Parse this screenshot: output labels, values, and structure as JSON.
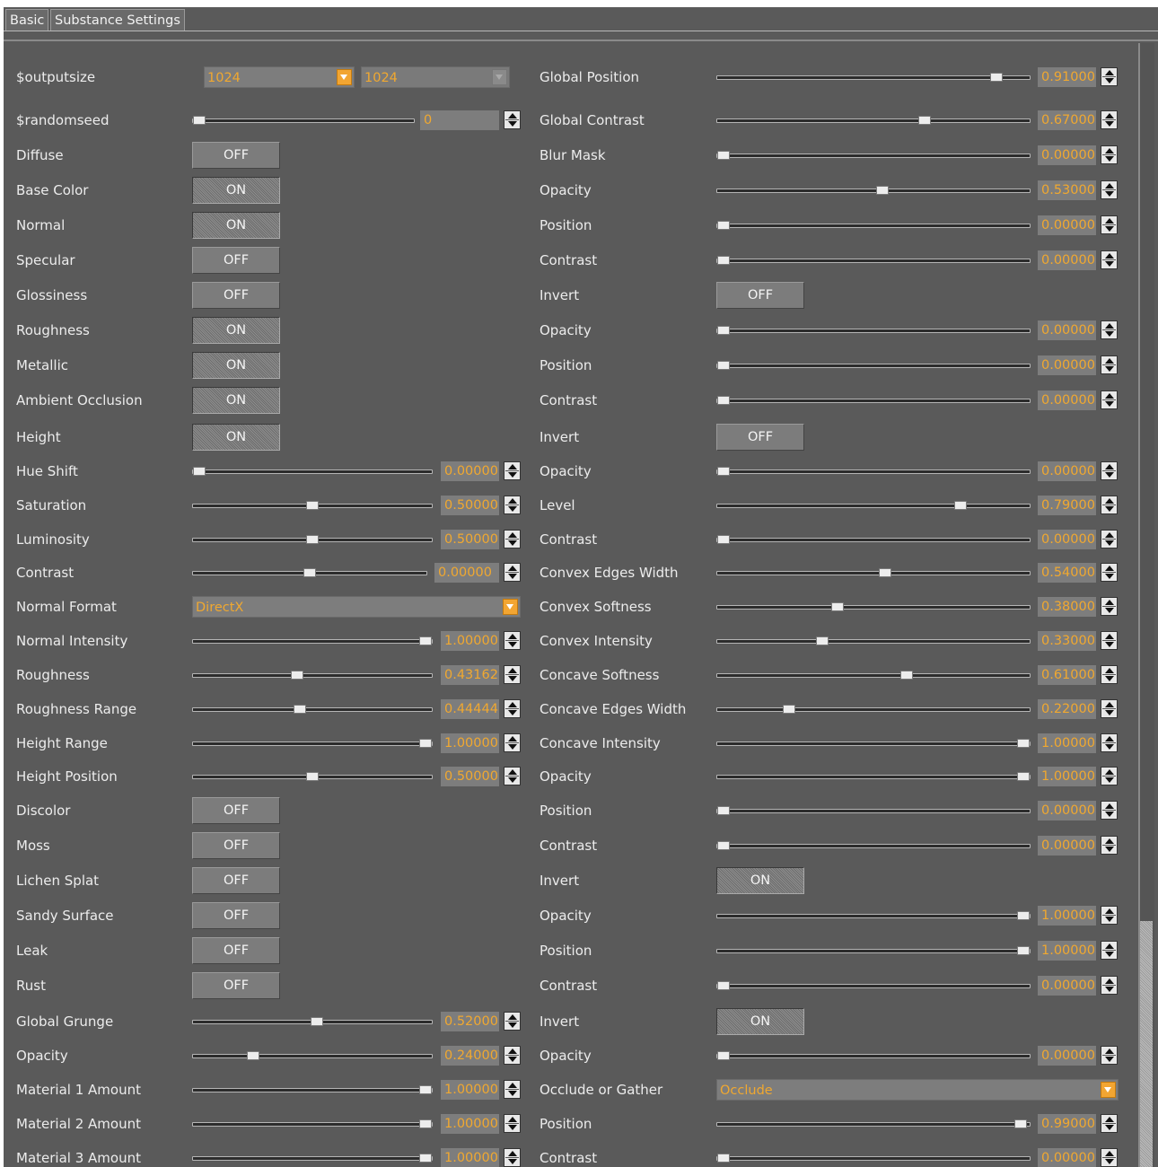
{
  "tabs": [
    "Basic",
    "Substance Settings"
  ],
  "colors": {
    "panel": "#5a5a5a",
    "value_text": "#f0a830",
    "label_text": "#ececec",
    "dropdown_arrow": "#f2a532"
  },
  "left": [
    {
      "label": "$outputsize",
      "type": "dual_dropdown",
      "values": [
        "1024",
        "1024"
      ]
    },
    {
      "label": "$randomseed",
      "type": "slider",
      "value": "0",
      "pos": 0.0
    },
    {
      "label": "Diffuse",
      "type": "toggle",
      "value": "OFF"
    },
    {
      "label": "Base Color",
      "type": "toggle",
      "value": "ON"
    },
    {
      "label": "Normal",
      "type": "toggle",
      "value": "ON"
    },
    {
      "label": "Specular",
      "type": "toggle",
      "value": "OFF"
    },
    {
      "label": "Glossiness",
      "type": "toggle",
      "value": "OFF"
    },
    {
      "label": "Roughness",
      "type": "toggle",
      "value": "ON"
    },
    {
      "label": "Metallic",
      "type": "toggle",
      "value": "ON"
    },
    {
      "label": "Ambient Occlusion",
      "type": "toggle",
      "value": "ON"
    },
    {
      "label": "Height",
      "type": "toggle",
      "value": "ON"
    },
    {
      "label": "Hue Shift",
      "type": "slider",
      "value": "0.00000",
      "pos": 0.0
    },
    {
      "label": "Saturation",
      "type": "slider",
      "value": "0.50000",
      "pos": 0.5
    },
    {
      "label": "Luminosity",
      "type": "slider",
      "value": "0.50000",
      "pos": 0.5
    },
    {
      "label": "Contrast",
      "type": "slider",
      "value": "0.00000",
      "pos": 0.5
    },
    {
      "label": "Normal Format",
      "type": "dropdown",
      "value": "DirectX"
    },
    {
      "label": "Normal Intensity",
      "type": "slider",
      "value": "1.00000",
      "pos": 1.0
    },
    {
      "label": "Roughness",
      "type": "slider",
      "value": "0.43162",
      "pos": 0.43162
    },
    {
      "label": "Roughness Range",
      "type": "slider",
      "value": "0.44444",
      "pos": 0.44444
    },
    {
      "label": "Height Range",
      "type": "slider",
      "value": "1.00000",
      "pos": 1.0
    },
    {
      "label": "Height Position",
      "type": "slider",
      "value": "0.50000",
      "pos": 0.5
    },
    {
      "label": "Discolor",
      "type": "toggle",
      "value": "OFF"
    },
    {
      "label": "Moss",
      "type": "toggle",
      "value": "OFF"
    },
    {
      "label": "Lichen Splat",
      "type": "toggle",
      "value": "OFF"
    },
    {
      "label": "Sandy Surface",
      "type": "toggle",
      "value": "OFF"
    },
    {
      "label": "Leak",
      "type": "toggle",
      "value": "OFF"
    },
    {
      "label": "Rust",
      "type": "toggle",
      "value": "OFF"
    },
    {
      "label": "Global Grunge",
      "type": "slider",
      "value": "0.52000",
      "pos": 0.52
    },
    {
      "label": "Opacity",
      "type": "slider",
      "value": "0.24000",
      "pos": 0.24
    },
    {
      "label": "Material 1 Amount",
      "type": "slider",
      "value": "1.00000",
      "pos": 1.0
    },
    {
      "label": "Material 2 Amount",
      "type": "slider",
      "value": "1.00000",
      "pos": 1.0
    },
    {
      "label": "Material 3 Amount",
      "type": "slider",
      "value": "1.00000",
      "pos": 1.0
    }
  ],
  "right": [
    {
      "label": "Global Position",
      "type": "slider",
      "value": "0.91000",
      "pos": 0.91
    },
    {
      "label": "Global Contrast",
      "type": "slider",
      "value": "0.67000",
      "pos": 0.67
    },
    {
      "label": "Blur Mask",
      "type": "slider",
      "value": "0.00000",
      "pos": 0.0
    },
    {
      "label": "Opacity",
      "type": "slider",
      "value": "0.53000",
      "pos": 0.53
    },
    {
      "label": "Position",
      "type": "slider",
      "value": "0.00000",
      "pos": 0.0
    },
    {
      "label": "Contrast",
      "type": "slider",
      "value": "0.00000",
      "pos": 0.0
    },
    {
      "label": "Invert",
      "type": "toggle",
      "value": "OFF"
    },
    {
      "label": "Opacity",
      "type": "slider",
      "value": "0.00000",
      "pos": 0.0
    },
    {
      "label": "Position",
      "type": "slider",
      "value": "0.00000",
      "pos": 0.0
    },
    {
      "label": "Contrast",
      "type": "slider",
      "value": "0.00000",
      "pos": 0.0
    },
    {
      "label": "Invert",
      "type": "toggle",
      "value": "OFF"
    },
    {
      "label": "Opacity",
      "type": "slider",
      "value": "0.00000",
      "pos": 0.0
    },
    {
      "label": "Level",
      "type": "slider",
      "value": "0.79000",
      "pos": 0.79
    },
    {
      "label": "Contrast",
      "type": "slider",
      "value": "0.00000",
      "pos": 0.0
    },
    {
      "label": "Convex Edges Width",
      "type": "slider",
      "value": "0.54000",
      "pos": 0.54
    },
    {
      "label": "Convex Softness",
      "type": "slider",
      "value": "0.38000",
      "pos": 0.38
    },
    {
      "label": "Convex Intensity",
      "type": "slider",
      "value": "0.33000",
      "pos": 0.33
    },
    {
      "label": "Concave Softness",
      "type": "slider",
      "value": "0.61000",
      "pos": 0.61
    },
    {
      "label": "Concave Edges Width",
      "type": "slider",
      "value": "0.22000",
      "pos": 0.22
    },
    {
      "label": "Concave Intensity",
      "type": "slider",
      "value": "1.00000",
      "pos": 1.0
    },
    {
      "label": "Opacity",
      "type": "slider",
      "value": "1.00000",
      "pos": 1.0
    },
    {
      "label": "Position",
      "type": "slider",
      "value": "0.00000",
      "pos": 0.0
    },
    {
      "label": "Contrast",
      "type": "slider",
      "value": "0.00000",
      "pos": 0.0
    },
    {
      "label": "Invert",
      "type": "toggle",
      "value": "ON"
    },
    {
      "label": "Opacity",
      "type": "slider",
      "value": "1.00000",
      "pos": 1.0
    },
    {
      "label": "Position",
      "type": "slider",
      "value": "1.00000",
      "pos": 1.0
    },
    {
      "label": "Contrast",
      "type": "slider",
      "value": "0.00000",
      "pos": 0.0
    },
    {
      "label": "Invert",
      "type": "toggle",
      "value": "ON"
    },
    {
      "label": "Opacity",
      "type": "slider",
      "value": "0.00000",
      "pos": 0.0
    },
    {
      "label": "Occlude or Gather",
      "type": "dropdown",
      "value": "Occlude"
    },
    {
      "label": "Position",
      "type": "slider",
      "value": "0.99000",
      "pos": 0.99
    },
    {
      "label": "Contrast",
      "type": "slider",
      "value": "0.00000",
      "pos": 0.0
    }
  ]
}
